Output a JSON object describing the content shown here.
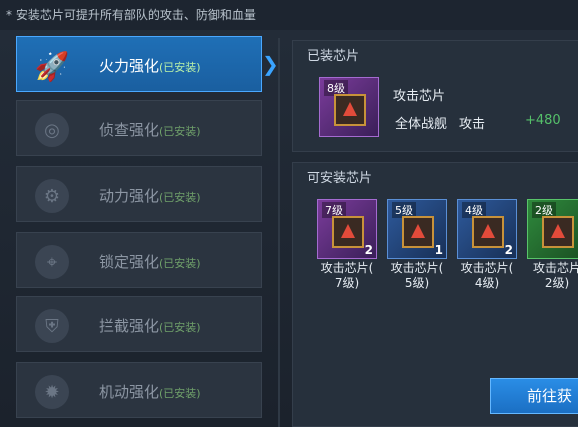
{
  "tip": "* 安装芯片可提升所有部队的攻击、防御和血量",
  "status_installed": "(已安装)",
  "sidebar": {
    "items": [
      {
        "label": "火力强化",
        "icon": "rocket-icon"
      },
      {
        "label": "侦查强化",
        "icon": "radar-icon"
      },
      {
        "label": "动力强化",
        "icon": "engine-icon"
      },
      {
        "label": "锁定强化",
        "icon": "target-lock-icon"
      },
      {
        "label": "拦截强化",
        "icon": "shield-device-icon"
      },
      {
        "label": "机动强化",
        "icon": "gear-emblem-icon"
      }
    ]
  },
  "installed": {
    "title": "已装芯片",
    "chip": {
      "level": "8级",
      "name": "攻击芯片",
      "target": "全体战舰",
      "stat": "攻击",
      "bonus": "+480"
    }
  },
  "available": {
    "title": "可安装芯片",
    "chips": [
      {
        "level": "7级",
        "count": "2",
        "label1": "攻击芯片(",
        "label2": "7级)",
        "color": "purple"
      },
      {
        "level": "5级",
        "count": "1",
        "label1": "攻击芯片(",
        "label2": "5级)",
        "color": "blue"
      },
      {
        "level": "4级",
        "count": "2",
        "label1": "攻击芯片(",
        "label2": "4级)",
        "color": "blue"
      },
      {
        "level": "2级",
        "count": "",
        "label1": "攻击芯片",
        "label2": "2级)",
        "color": "green"
      }
    ]
  },
  "goto_button": "前往获"
}
